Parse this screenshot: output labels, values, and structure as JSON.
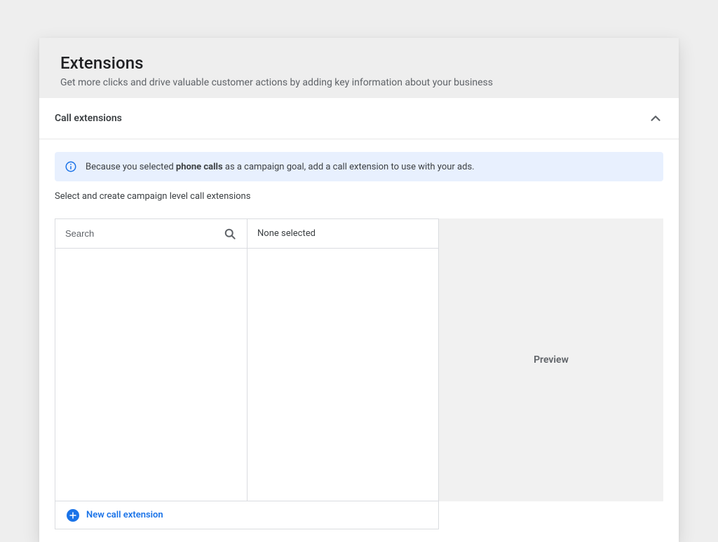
{
  "header": {
    "title": "Extensions",
    "subtitle": "Get more clicks and drive valuable customer actions by adding key information about your business"
  },
  "section": {
    "title": "Call extensions",
    "info_pre": "Because you selected ",
    "info_bold": "phone calls",
    "info_post": " as a campaign goal, add a call extension to use with your ads.",
    "instruction": "Select and create campaign level call extensions",
    "search_placeholder": "Search",
    "none_selected": "None selected",
    "preview": "Preview",
    "new_link": "New call extension"
  }
}
